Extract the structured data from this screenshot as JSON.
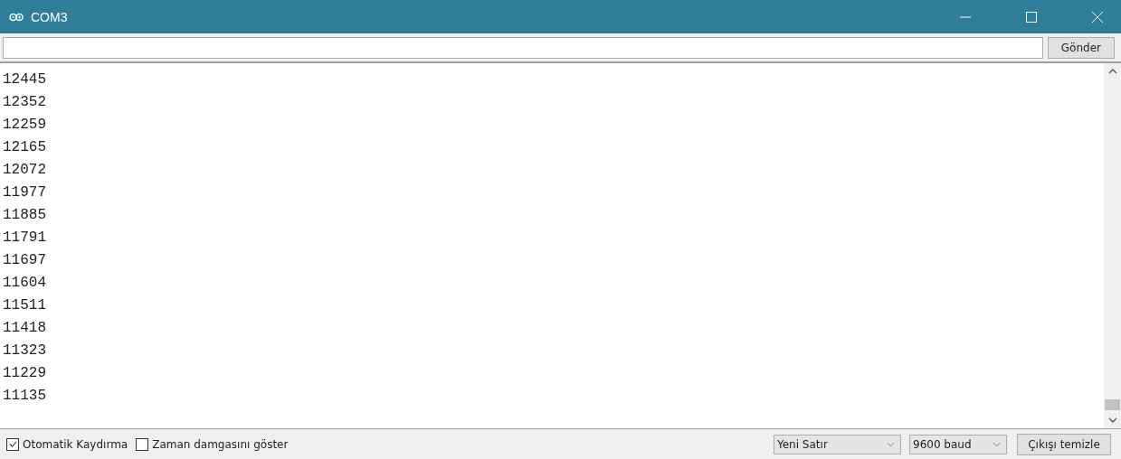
{
  "window": {
    "title": "COM3"
  },
  "input": {
    "button": "Gönder"
  },
  "output": [
    "12445",
    "12352",
    "12259",
    "12165",
    "12072",
    "11977",
    "11885",
    "11791",
    "11697",
    "11604",
    "11511",
    "11418",
    "11323",
    "11229",
    "11135"
  ],
  "footer": {
    "autoscroll": {
      "label": "Otomatik Kaydırma",
      "checked": true
    },
    "timestamp": {
      "label": "Zaman damgasını göster",
      "checked": false
    },
    "line_ending": "Yeni Satır",
    "baud": "9600 baud",
    "clear": "Çıkışı temizle"
  }
}
